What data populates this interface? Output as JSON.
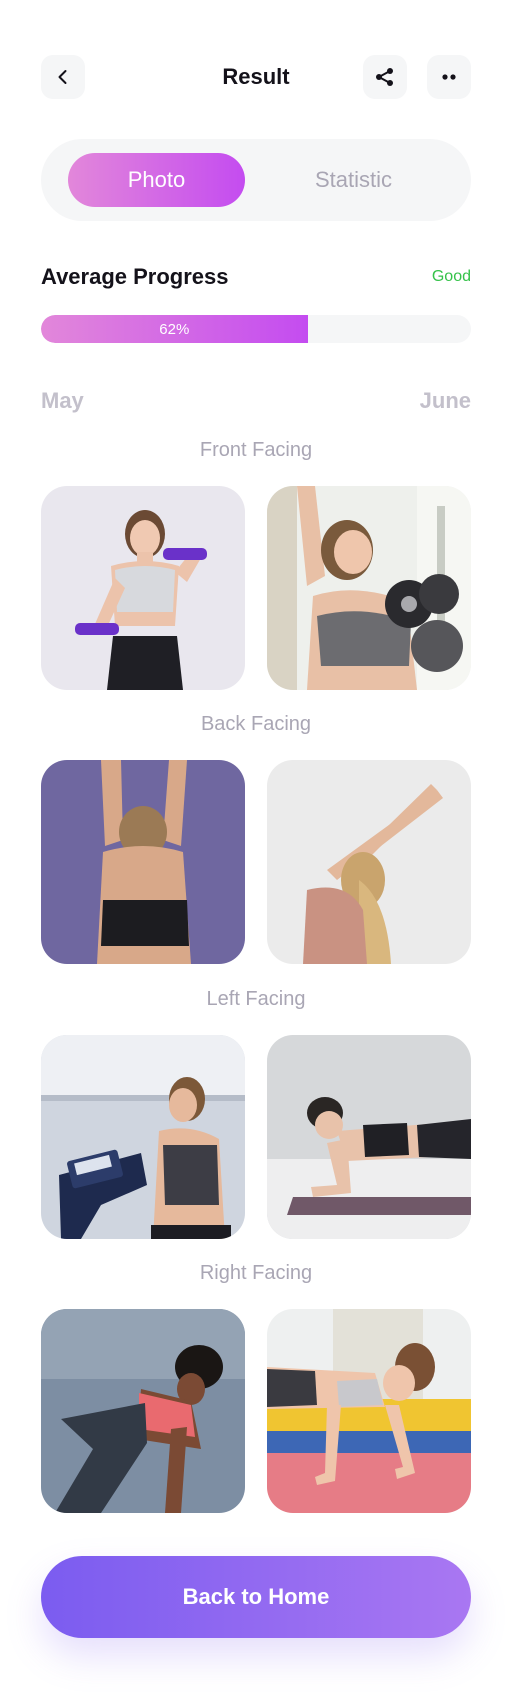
{
  "header": {
    "title": "Result",
    "back_icon": "chevron-left-icon",
    "share_icon": "share-icon",
    "more_icon": "more-dots-icon"
  },
  "tabs": [
    {
      "label": "Photo",
      "active": true
    },
    {
      "label": "Statistic",
      "active": false
    }
  ],
  "progress": {
    "title": "Average Progress",
    "status": "Good",
    "status_color": "#35c24a",
    "value_label": "62%",
    "value": 0.62
  },
  "months": {
    "start": "May",
    "end": "June"
  },
  "sections": [
    {
      "label": "Front Facing",
      "photos": [
        "woman-dumbbells-photo",
        "woman-dumbbell-gym-photo"
      ]
    },
    {
      "label": "Back Facing",
      "photos": [
        "woman-back-stretch-photo",
        "woman-side-stretch-photo"
      ]
    },
    {
      "label": "Left Facing",
      "photos": [
        "woman-exercise-bike-photo",
        "woman-plank-photo"
      ]
    },
    {
      "label": "Right Facing",
      "photos": [
        "woman-stretching-outdoor-photo",
        "woman-pushup-photo"
      ]
    }
  ],
  "cta": {
    "label": "Back to Home"
  },
  "colors": {
    "accent_gradient_start": "#e287da",
    "accent_gradient_end": "#c44cf0",
    "button_gradient_start": "#7b5cf0",
    "button_gradient_end": "#a977f2",
    "muted_text": "#a9a6b4"
  }
}
